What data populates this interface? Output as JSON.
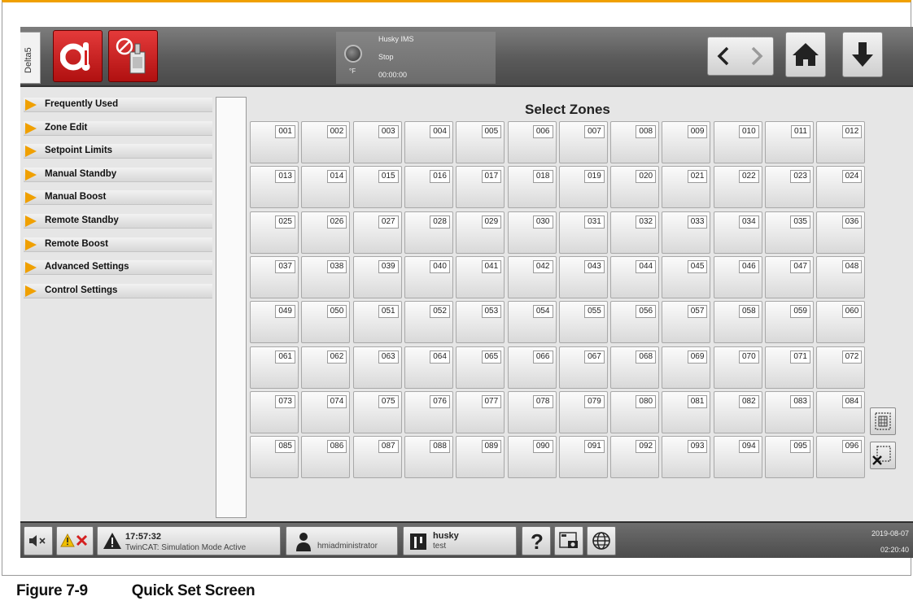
{
  "header": {
    "delta_tab": "Delta5",
    "status": {
      "line1": "Husky IMS",
      "line2": "Stop",
      "line3": "00:00:00",
      "unit": "°F"
    }
  },
  "menu": {
    "items": [
      {
        "label": "Frequently Used"
      },
      {
        "label": "Zone Edit"
      },
      {
        "label": "Setpoint Limits"
      },
      {
        "label": "Manual Standby"
      },
      {
        "label": "Manual Boost"
      },
      {
        "label": "Remote Standby"
      },
      {
        "label": "Remote Boost"
      },
      {
        "label": "Advanced Settings"
      },
      {
        "label": "Control Settings"
      }
    ]
  },
  "main": {
    "title": "Select Zones",
    "zones": [
      "001",
      "002",
      "003",
      "004",
      "005",
      "006",
      "007",
      "008",
      "009",
      "010",
      "011",
      "012",
      "013",
      "014",
      "015",
      "016",
      "017",
      "018",
      "019",
      "020",
      "021",
      "022",
      "023",
      "024",
      "025",
      "026",
      "027",
      "028",
      "029",
      "030",
      "031",
      "032",
      "033",
      "034",
      "035",
      "036",
      "037",
      "038",
      "039",
      "040",
      "041",
      "042",
      "043",
      "044",
      "045",
      "046",
      "047",
      "048",
      "049",
      "050",
      "051",
      "052",
      "053",
      "054",
      "055",
      "056",
      "057",
      "058",
      "059",
      "060",
      "061",
      "062",
      "063",
      "064",
      "065",
      "066",
      "067",
      "068",
      "069",
      "070",
      "071",
      "072",
      "073",
      "074",
      "075",
      "076",
      "077",
      "078",
      "079",
      "080",
      "081",
      "082",
      "083",
      "084",
      "085",
      "086",
      "087",
      "088",
      "089",
      "090",
      "091",
      "092",
      "093",
      "094",
      "095",
      "096"
    ]
  },
  "footer": {
    "alarm_time": "17:57:32",
    "alarm_text": "TwinCAT: Simulation Mode Active",
    "user": "hmiadministrator",
    "mold_name": "husky",
    "mold_sub": "test",
    "date": "2019-08-07",
    "time": "02:20:40"
  },
  "caption": {
    "number": "Figure 7-9",
    "title": "Quick Set Screen"
  },
  "colors": {
    "accent": "#f0a000",
    "alarm_red": "#d42020",
    "header_gray": "#5a5a5a"
  }
}
